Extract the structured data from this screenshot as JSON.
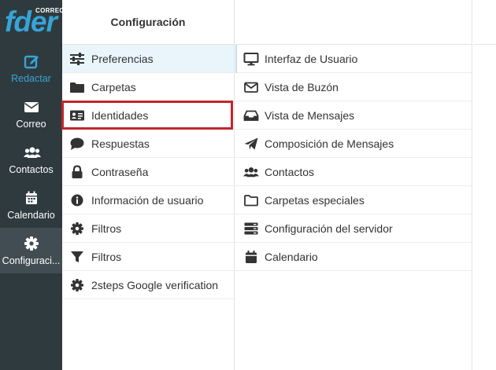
{
  "brand": {
    "logo_text": "fder",
    "logo_small": "CORREO",
    "accent": "#37a4d6"
  },
  "nav": [
    {
      "id": "compose",
      "label": "Redactar",
      "icon": "compose-icon"
    },
    {
      "id": "mail",
      "label": "Correo",
      "icon": "envelope-icon"
    },
    {
      "id": "contacts",
      "label": "Contactos",
      "icon": "users-icon"
    },
    {
      "id": "calendar",
      "label": "Calendario",
      "icon": "calendar-icon"
    },
    {
      "id": "settings",
      "label": "Configuraci...",
      "icon": "gear-icon",
      "active": true
    }
  ],
  "settings_column": {
    "title": "Configuración",
    "items": [
      {
        "label": "Preferencias",
        "icon": "sliders-icon",
        "selected": true
      },
      {
        "label": "Carpetas",
        "icon": "folder-icon"
      },
      {
        "label": "Identidades",
        "icon": "id-card-icon",
        "highlighted": true
      },
      {
        "label": "Respuestas",
        "icon": "comment-icon"
      },
      {
        "label": "Contraseña",
        "icon": "lock-icon"
      },
      {
        "label": "Información de usuario",
        "icon": "info-icon"
      },
      {
        "label": "Filtros",
        "icon": "gear-icon"
      },
      {
        "label": "Filtros",
        "icon": "funnel-icon"
      },
      {
        "label": "2steps Google verification",
        "icon": "gear-icon"
      }
    ]
  },
  "sections_column": {
    "items": [
      {
        "label": "Interfaz de Usuario",
        "icon": "monitor-icon"
      },
      {
        "label": "Vista de Buzón",
        "icon": "envelope-outline-icon"
      },
      {
        "label": "Vista de Mensajes",
        "icon": "inbox-icon"
      },
      {
        "label": "Composición de Mensajes",
        "icon": "paper-plane-icon"
      },
      {
        "label": "Contactos",
        "icon": "users-icon"
      },
      {
        "label": "Carpetas especiales",
        "icon": "folder-outline-icon"
      },
      {
        "label": "Configuración del servidor",
        "icon": "server-icon"
      },
      {
        "label": "Calendario",
        "icon": "calendar-icon"
      }
    ]
  }
}
